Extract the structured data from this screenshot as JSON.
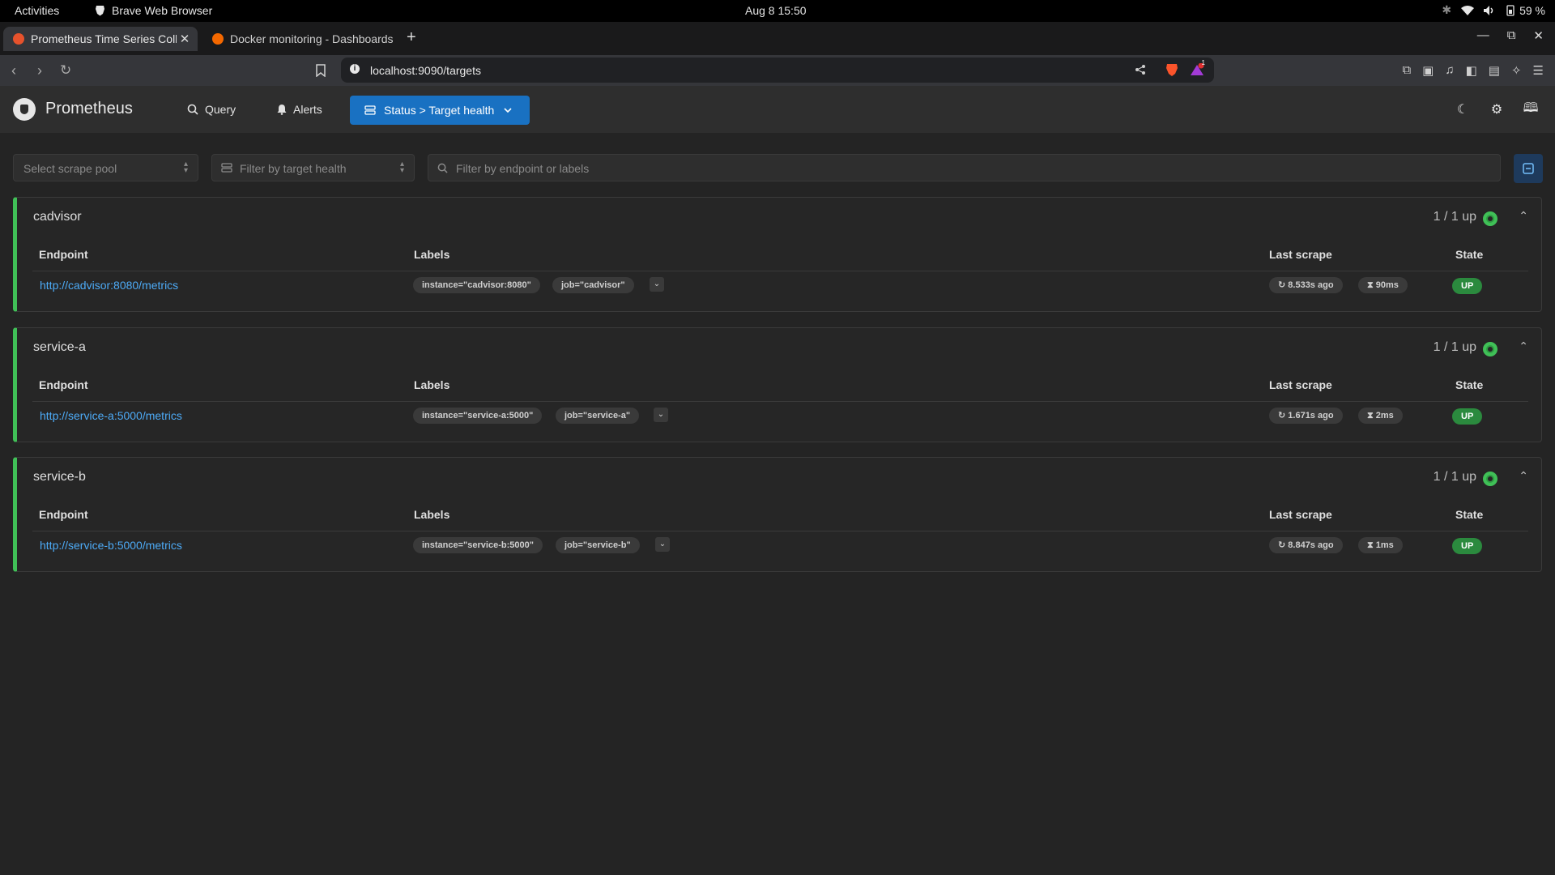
{
  "os": {
    "activities": "Activities",
    "app_name": "Brave Web Browser",
    "clock": "Aug 8  15:50",
    "battery": "59 %"
  },
  "tabs": [
    {
      "title": "Prometheus Time Series Collection and Processing Server",
      "favicon_color": "#e6522c",
      "active": true
    },
    {
      "title": "Docker monitoring - Dashboards - Grafana",
      "favicon_color": "#f46800",
      "active": false
    }
  ],
  "address_bar": {
    "url": "localhost:9090/targets",
    "notification_count": "1"
  },
  "prometheus": {
    "brand": "Prometheus",
    "nav": {
      "query": "Query",
      "alerts": "Alerts",
      "status": "Status > Target health"
    }
  },
  "filters": {
    "scrape_pool_placeholder": "Select scrape pool",
    "health_placeholder": "Filter by target health",
    "search_placeholder": "Filter by endpoint or labels"
  },
  "table_headers": {
    "endpoint": "Endpoint",
    "labels": "Labels",
    "last_scrape": "Last scrape",
    "state": "State"
  },
  "pools": [
    {
      "name": "cadvisor",
      "up_count": "1 / 1 up",
      "endpoint": "http://cadvisor:8080/metrics",
      "labels": [
        "instance=\"cadvisor:8080\"",
        "job=\"cadvisor\""
      ],
      "last_scrape": "8.533s ago",
      "duration": "90ms",
      "state": "UP"
    },
    {
      "name": "service-a",
      "up_count": "1 / 1 up",
      "endpoint": "http://service-a:5000/metrics",
      "labels": [
        "instance=\"service-a:5000\"",
        "job=\"service-a\""
      ],
      "last_scrape": "1.671s ago",
      "duration": "2ms",
      "state": "UP"
    },
    {
      "name": "service-b",
      "up_count": "1 / 1 up",
      "endpoint": "http://service-b:5000/metrics",
      "labels": [
        "instance=\"service-b:5000\"",
        "job=\"service-b\""
      ],
      "last_scrape": "8.847s ago",
      "duration": "1ms",
      "state": "UP"
    }
  ],
  "colors": {
    "accent": "#1971c2",
    "up_green": "#40c057",
    "link_blue": "#4dabf7"
  }
}
